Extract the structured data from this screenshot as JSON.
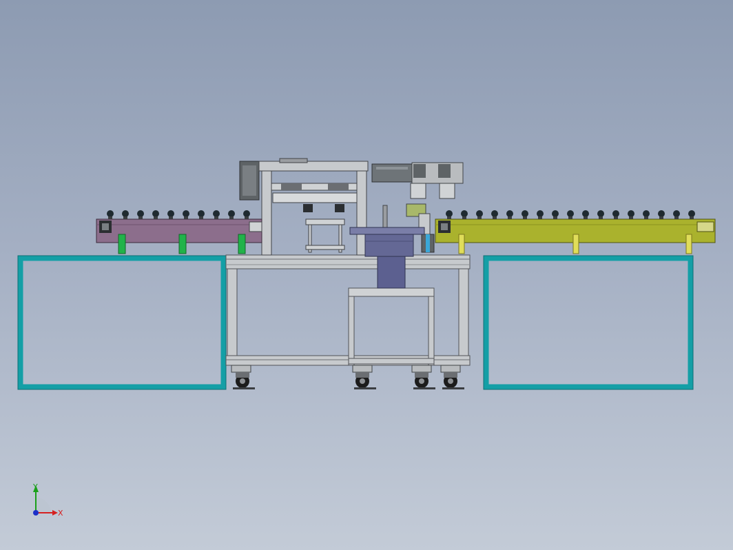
{
  "viewport": {
    "background_top": "#8d9bb2",
    "background_bottom": "#c3cbd7"
  },
  "model": {
    "colors": {
      "left_conveyor": "#8c6e8c",
      "right_conveyor": "#aab22d",
      "frame_outline": "#149fa6",
      "steel": "#c7cacd",
      "steel_dark": "#6b6e72",
      "bracket_green": "#21b34a",
      "bracket_yellow": "#c8c32f",
      "drum": "#646895",
      "roller": "#1f2a30",
      "wheel": "#1c1c1c",
      "motor": "#5e6366"
    }
  },
  "triad": {
    "x_label": "X",
    "y_label": "Y",
    "x_color": "#d62020",
    "y_color": "#1aa01a",
    "z_color": "#1c2fc8"
  }
}
